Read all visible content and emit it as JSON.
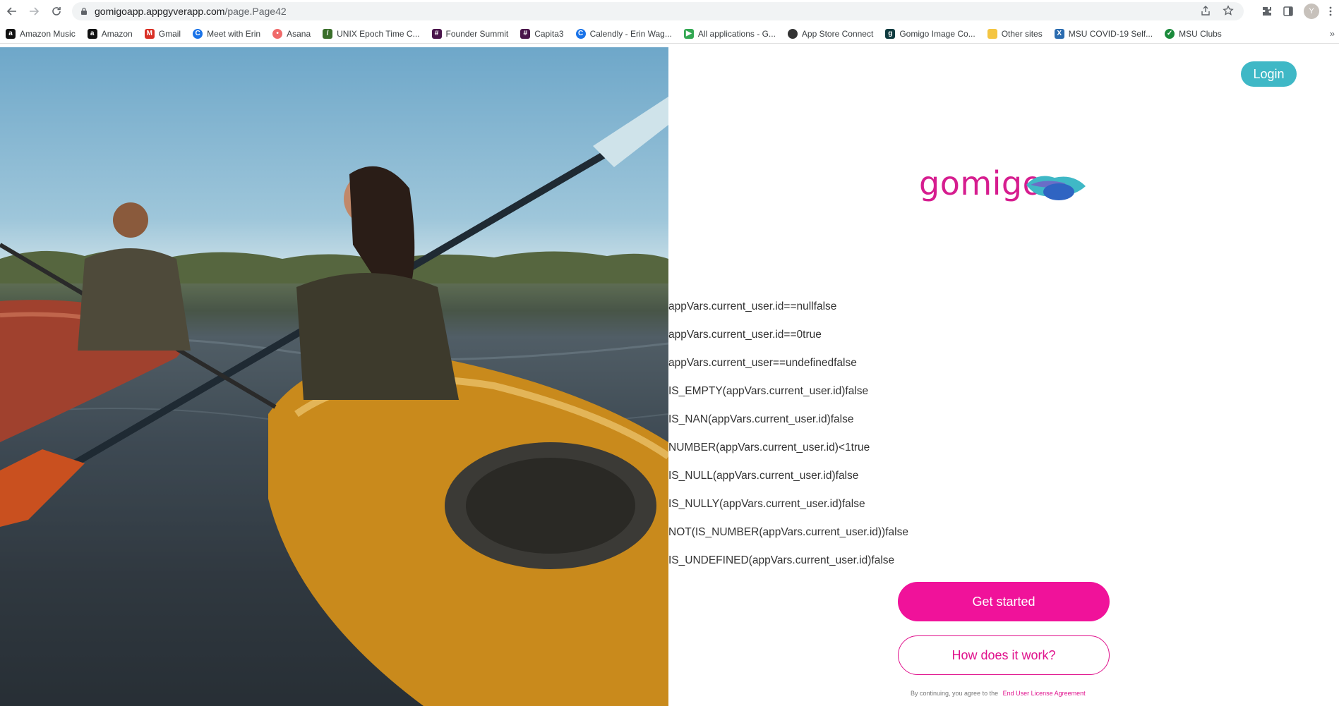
{
  "browser": {
    "url_host": "gomigoapp.appgyverapp.com",
    "url_path": "/page.Page42",
    "profile_initial": "Y",
    "bookmarks": [
      {
        "label": "Amazon Music",
        "icon": "amazon-icon",
        "color": "#111111"
      },
      {
        "label": "Amazon",
        "icon": "amazon-icon",
        "color": "#111111"
      },
      {
        "label": "Gmail",
        "icon": "gmail-icon",
        "color": "#d93025"
      },
      {
        "label": "Meet with Erin",
        "icon": "calendly-icon",
        "color": "#1a73e8"
      },
      {
        "label": "Asana",
        "icon": "asana-icon",
        "color": "#f06a6a"
      },
      {
        "label": "UNIX Epoch Time C...",
        "icon": "epoch-icon",
        "color": "#3a6e2a"
      },
      {
        "label": "Founder Summit",
        "icon": "slack-icon",
        "color": "#4a154b"
      },
      {
        "label": "Capita3",
        "icon": "slack-icon",
        "color": "#4a154b"
      },
      {
        "label": "Calendly - Erin Wag...",
        "icon": "calendly-icon",
        "color": "#1a73e8"
      },
      {
        "label": "All applications - G...",
        "icon": "play-console-icon",
        "color": "#34a853"
      },
      {
        "label": "App Store Connect",
        "icon": "apple-icon",
        "color": "#333333"
      },
      {
        "label": "Gomigo Image Co...",
        "icon": "gomigo-icon",
        "color": "#0f3b3f"
      },
      {
        "label": "Other sites",
        "icon": "folder-icon",
        "color": "#f4c542"
      },
      {
        "label": "MSU COVID-19 Self...",
        "icon": "xm-icon",
        "color": "#2b6cb0"
      },
      {
        "label": "MSU Clubs",
        "icon": "msu-icon",
        "color": "#1b8a3b"
      }
    ]
  },
  "header": {
    "login_label": "Login"
  },
  "logo": {
    "text": "gomigo",
    "brand_color": "#d61d8f",
    "accent_color": "#3fb8c6"
  },
  "debug_lines": [
    "appVars.current_user.id==nullfalse",
    "appVars.current_user.id==0true",
    "appVars.current_user==undefinedfalse",
    "IS_EMPTY(appVars.current_user.id)false",
    "IS_NAN(appVars.current_user.id)false",
    "NUMBER(appVars.current_user.id)<1true",
    "IS_NULL(appVars.current_user.id)false",
    "IS_NULLY(appVars.current_user.id)false",
    "NOT(IS_NUMBER(appVars.current_user.id))false",
    "IS_UNDEFINED(appVars.current_user.id)false"
  ],
  "actions": {
    "primary_label": "Get started",
    "secondary_label": "How does it work?",
    "primary_color": "#f0129a"
  },
  "terms": {
    "prefix": "By continuing, you agree to the",
    "link_label": "End User License Agreement"
  }
}
